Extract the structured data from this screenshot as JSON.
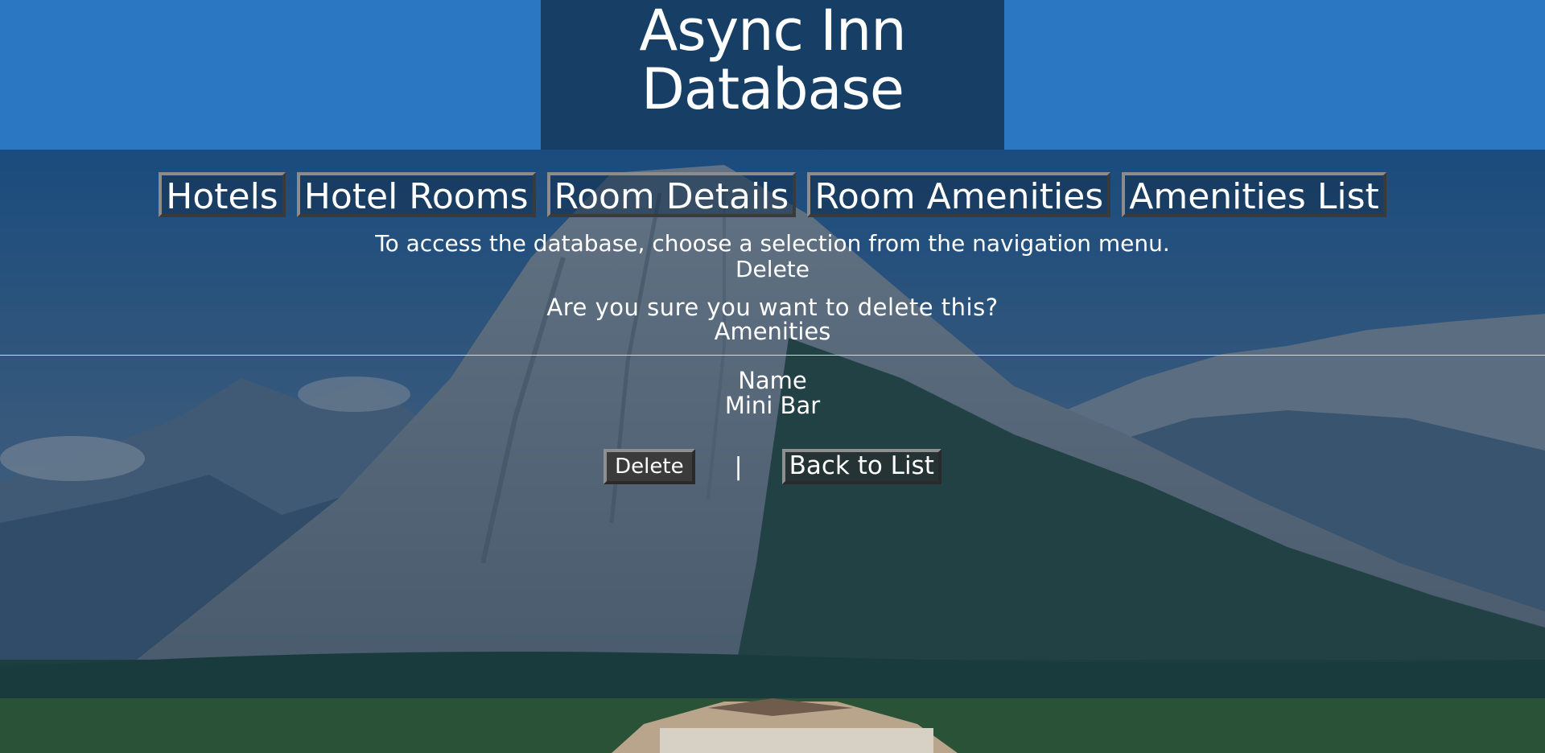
{
  "header": {
    "title_line1": "Async Inn",
    "title_line2": "Database"
  },
  "nav": {
    "items": [
      {
        "label": "Hotels"
      },
      {
        "label": "Hotel Rooms"
      },
      {
        "label": "Room Details"
      },
      {
        "label": "Room Amenities"
      },
      {
        "label": "Amenities List"
      }
    ]
  },
  "main": {
    "intro": "To access the database, choose a selection from the navigation menu.",
    "page_heading": "Delete",
    "confirm_question": "Are you sure you want to delete this?",
    "entity_name": "Amenities",
    "field_label": "Name",
    "field_value": "Mini Bar",
    "delete_label": "Delete",
    "separator": "|",
    "back_label": "Back to List"
  },
  "colors": {
    "sky": "#2c77c2",
    "header_bg": "#173f66",
    "overlay": "rgba(12, 40, 70, 0.55)",
    "button_bg": "#3b3b3b",
    "text": "#ffffff"
  },
  "background": {
    "description_icon": "mountain-landscape-image"
  }
}
